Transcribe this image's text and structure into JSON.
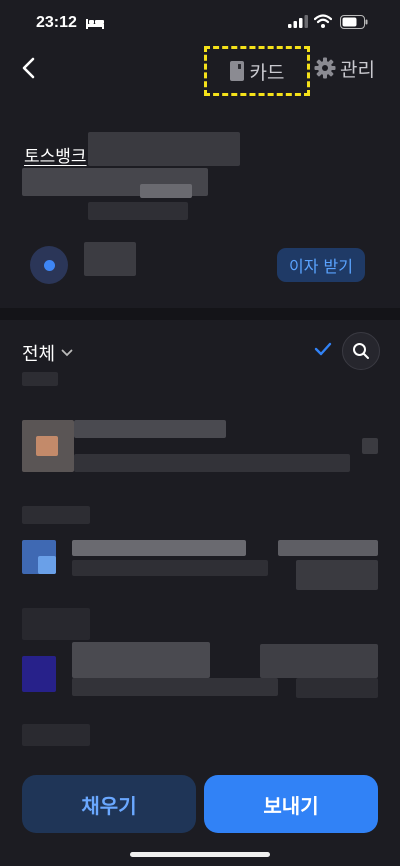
{
  "status_bar": {
    "time": "23:12"
  },
  "header": {
    "card_label": "카드",
    "manage_label": "관리"
  },
  "account": {
    "bank_name": "토스뱅크",
    "interest_button": "이자 받기"
  },
  "list": {
    "filter_label": "전체"
  },
  "footer": {
    "fill_button": "채우기",
    "send_button": "보내기"
  },
  "colors": {
    "accent": "#3182f6",
    "highlight_border": "#f5e21a",
    "background": "#1c1c22"
  }
}
